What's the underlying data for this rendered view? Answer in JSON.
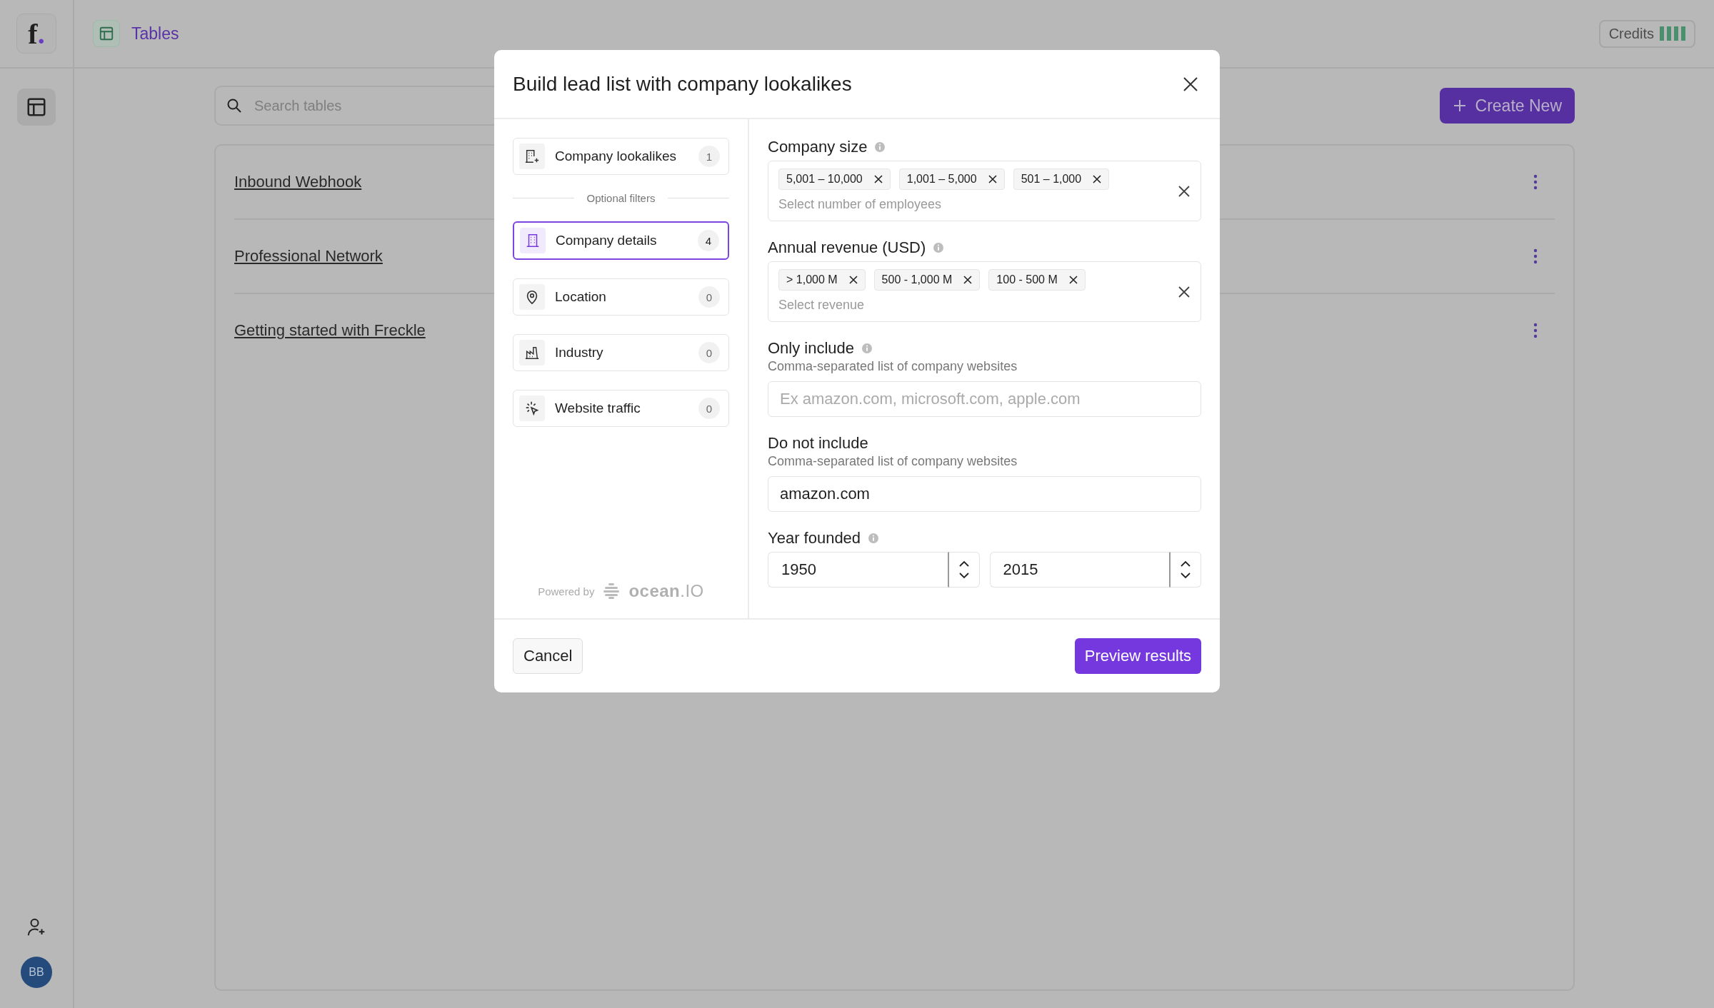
{
  "logo": {
    "letter": "f",
    "dot": "."
  },
  "header": {
    "title": "Tables",
    "credits_label": "Credits"
  },
  "rail": {
    "avatar_initials": "BB"
  },
  "search": {
    "placeholder": "Search tables"
  },
  "create_button": "Create New",
  "tables": [
    {
      "name": "Inbound Webhook"
    },
    {
      "name": "Professional Network"
    },
    {
      "name": "Getting started with Freckle"
    }
  ],
  "modal": {
    "title": "Build lead list with company lookalikes",
    "nav": [
      {
        "kind": "item",
        "label": "Company lookalikes",
        "count": "1",
        "selected": false
      },
      {
        "kind": "divider",
        "label": "Optional filters"
      },
      {
        "kind": "item",
        "label": "Company details",
        "count": "4",
        "selected": true
      },
      {
        "kind": "item",
        "label": "Location",
        "count": "0",
        "selected": false
      },
      {
        "kind": "item",
        "label": "Industry",
        "count": "0",
        "selected": false
      },
      {
        "kind": "item",
        "label": "Website traffic",
        "count": "0",
        "selected": false
      }
    ],
    "powered_by": "Powered by",
    "brand": {
      "name": "ocean",
      "suffix": ".IO"
    },
    "filters": [
      {
        "kind": "multiselect",
        "label": "Company size",
        "info": true,
        "chips": [
          "5,001 – 10,000",
          "1,001 – 5,000",
          "501 – 1,000"
        ],
        "placeholder": "Select number of employees"
      },
      {
        "kind": "multiselect",
        "label": "Annual revenue (USD)",
        "info": true,
        "chips": [
          "> 1,000 M",
          "500 - 1,000 M",
          "100 - 500 M"
        ],
        "placeholder": "Select revenue"
      },
      {
        "kind": "text",
        "label": "Only include",
        "info": true,
        "hint": "Comma-separated list of company websites",
        "placeholder": "Ex amazon.com, microsoft.com, apple.com"
      },
      {
        "kind": "text",
        "label": "Do not include",
        "info": false,
        "hint": "Comma-separated list of company websites",
        "value": "amazon.com"
      },
      {
        "kind": "range",
        "label": "Year founded",
        "info": true,
        "values": [
          "1950",
          "2015"
        ]
      }
    ],
    "cancel": "Cancel",
    "submit": "Preview results"
  }
}
